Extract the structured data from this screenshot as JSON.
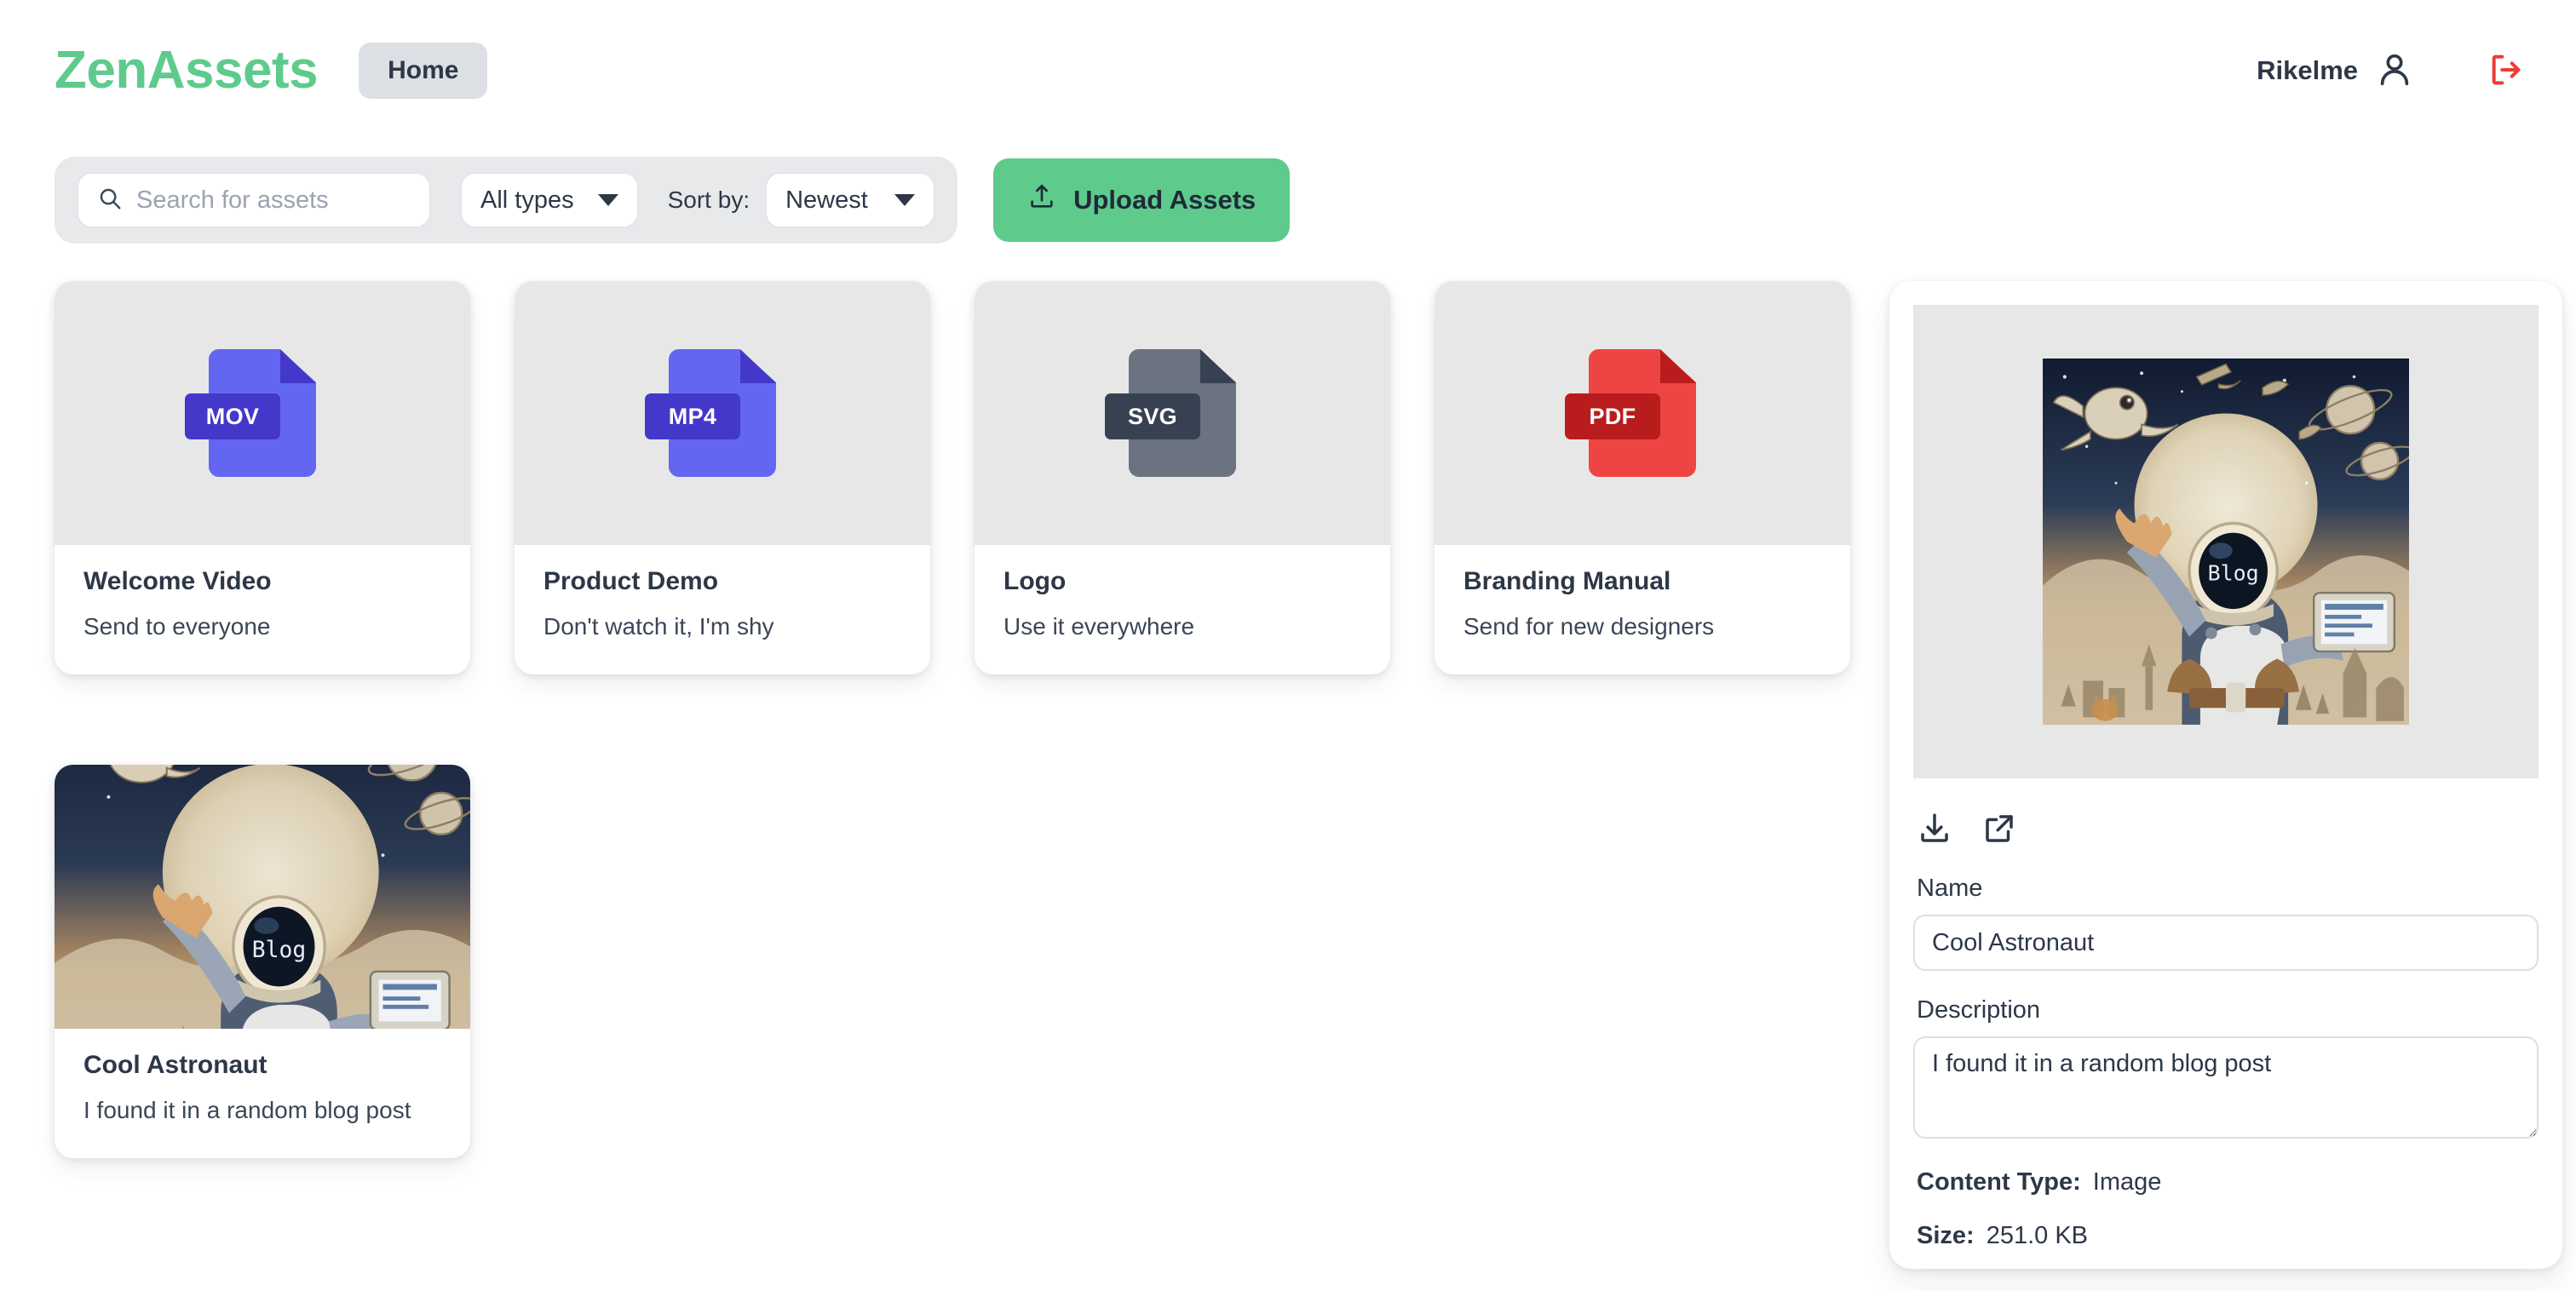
{
  "header": {
    "brand": "ZenAssets",
    "nav_home_label": "Home",
    "user_name": "Rikelme",
    "user_icon": "user-avatar-icon",
    "logout_icon": "logout-icon",
    "logout_color": "#ef3b35"
  },
  "toolbar": {
    "search_placeholder": "Search for assets",
    "search_value": "",
    "search_icon": "search-icon",
    "type_filter_value": "All types",
    "sort_prefix": "Sort by:",
    "sort_value": "Newest",
    "upload_label": "Upload Assets",
    "upload_icon": "upload-icon",
    "accent_color": "#5ecb8c"
  },
  "assets": [
    {
      "title": "Welcome Video",
      "description": "Send to everyone",
      "kind": "file",
      "ext": "MOV",
      "body_color": "#6366f1",
      "accent_color": "#4338ca"
    },
    {
      "title": "Product Demo",
      "description": "Don't watch it, I'm shy",
      "kind": "file",
      "ext": "MP4",
      "body_color": "#6366f1",
      "accent_color": "#4338ca"
    },
    {
      "title": "Logo",
      "description": "Use it everywhere",
      "kind": "file",
      "ext": "SVG",
      "body_color": "#6b7280",
      "accent_color": "#374151"
    },
    {
      "title": "Branding Manual",
      "description": "Send for new designers",
      "kind": "file",
      "ext": "PDF",
      "body_color": "#ef4444",
      "accent_color": "#b91c1c"
    },
    {
      "title": "Cool Astronaut",
      "description": "I found it in a random blog post",
      "kind": "image",
      "ext": "",
      "body_color": "",
      "accent_color": ""
    }
  ],
  "detail": {
    "preview_alt": "astronaut-illustration",
    "download_icon": "download-icon",
    "open_external_icon": "external-link-icon",
    "name_label": "Name",
    "name_value": "Cool Astronaut",
    "description_label": "Description",
    "description_value": "I found it in a random blog post",
    "content_type_label": "Content Type:",
    "content_type_value": "Image",
    "size_label": "Size:",
    "size_value": "251.0 KB"
  },
  "artwork": {
    "visor_text": "Blog"
  }
}
